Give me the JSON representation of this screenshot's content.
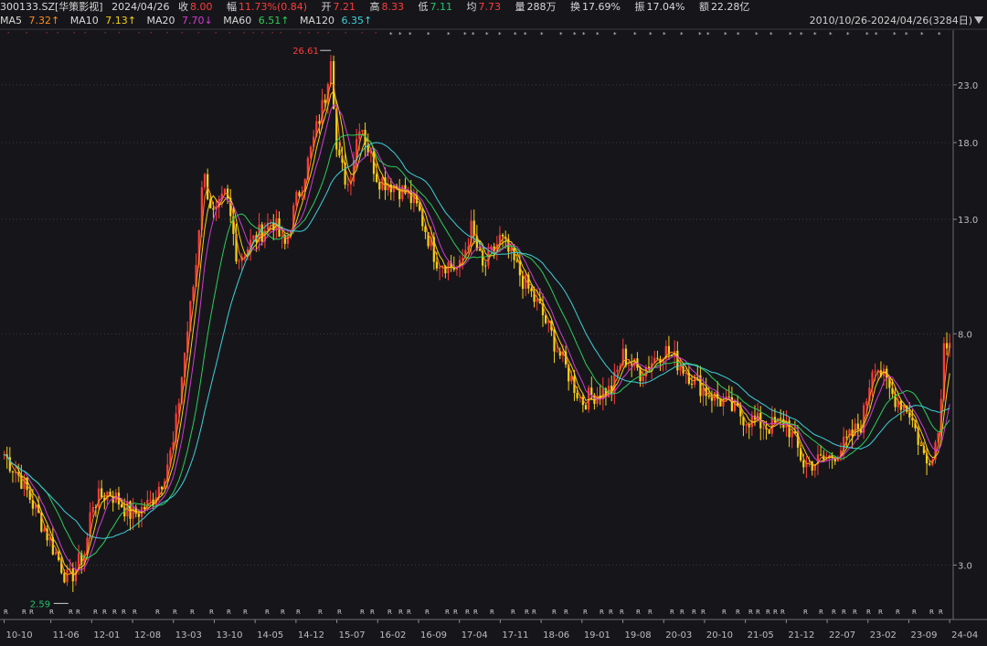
{
  "quote": {
    "symbol": "300133.SZ[华策影视]",
    "date": "2024/04/26",
    "close_label": "收",
    "close": "8.00",
    "change_label": "幅",
    "change": "11.73%(0.84)",
    "open_label": "开",
    "open": "7.21",
    "high_label": "高",
    "high": "8.33",
    "low_label": "低",
    "low": "7.11",
    "avg_label": "均",
    "avg": "7.73",
    "vol_label": "量",
    "vol": "288万",
    "turnover_label": "换",
    "turnover": "17.69%",
    "amplitude_label": "振",
    "amplitude": "17.04%",
    "amount_label": "额",
    "amount": "22.28亿"
  },
  "ma_legend": [
    {
      "label": "MA5",
      "value": "7.32↑",
      "color": "#ff8c1a"
    },
    {
      "label": "MA10",
      "value": "7.13↑",
      "color": "#f3d21a"
    },
    {
      "label": "MA20",
      "value": "7.70↓",
      "color": "#d23bd2"
    },
    {
      "label": "MA60",
      "value": "6.51↑",
      "color": "#2ecc5a"
    },
    {
      "label": "MA120",
      "value": "6.35↑",
      "color": "#3fd0d8"
    }
  ],
  "range_text": "2010/10/26-2024/04/26(3284日)",
  "colors": {
    "up": "#ff3b3b",
    "down": "#f3d21a",
    "bg": "#16161a",
    "grid": "#3a3a40"
  },
  "chart_data": {
    "type": "candlestick",
    "y_axis": {
      "scale": "log",
      "ticks": [
        "3.0",
        "8.0",
        "13.0",
        "18.0",
        "23.0"
      ],
      "ylim": [
        2.4,
        29
      ]
    },
    "x_ticks": [
      "10-10",
      "11-06",
      "12-01",
      "12-08",
      "13-03",
      "13-10",
      "14-05",
      "14-12",
      "15-07",
      "16-02",
      "16-09",
      "17-04",
      "17-11",
      "18-06",
      "19-01",
      "19-08",
      "20-03",
      "20-10",
      "21-05",
      "21-12",
      "22-07",
      "23-02",
      "23-09",
      "24-04"
    ],
    "annotations": {
      "max": "26.61",
      "min": "2.59"
    },
    "price_path": [
      [
        "10-10",
        4.8
      ],
      [
        "11-01",
        4.3
      ],
      [
        "11-06",
        3.3
      ],
      [
        "11-09",
        2.8
      ],
      [
        "11-12",
        3.2
      ],
      [
        "12-01",
        3.9
      ],
      [
        "12-04",
        4.1
      ],
      [
        "12-08",
        3.7
      ],
      [
        "12-11",
        3.9
      ],
      [
        "13-01",
        4.3
      ],
      [
        "13-03",
        5.0
      ],
      [
        "13-05",
        7.5
      ],
      [
        "13-07",
        11.0
      ],
      [
        "13-08",
        16.0
      ],
      [
        "13-10",
        13.0
      ],
      [
        "13-12",
        14.5
      ],
      [
        "14-02",
        11.0
      ],
      [
        "14-05",
        12.0
      ],
      [
        "14-08",
        13.0
      ],
      [
        "14-10",
        11.5
      ],
      [
        "14-12",
        14.0
      ],
      [
        "15-02",
        16.5
      ],
      [
        "15-05",
        22.0
      ],
      [
        "15-06",
        26.6
      ],
      [
        "15-07",
        17.0
      ],
      [
        "15-09",
        15.0
      ],
      [
        "15-11",
        20.0
      ],
      [
        "15-12",
        18.0
      ],
      [
        "16-02",
        15.5
      ],
      [
        "16-05",
        15.0
      ],
      [
        "16-07",
        14.5
      ],
      [
        "16-09",
        13.5
      ],
      [
        "16-12",
        11.0
      ],
      [
        "17-04",
        10.5
      ],
      [
        "17-06",
        12.5
      ],
      [
        "17-08",
        10.5
      ],
      [
        "17-11",
        12.0
      ],
      [
        "18-01",
        11.0
      ],
      [
        "18-03",
        10.0
      ],
      [
        "18-06",
        8.8
      ],
      [
        "18-10",
        7.0
      ],
      [
        "19-01",
        6.0
      ],
      [
        "19-03",
        6.2
      ],
      [
        "19-06",
        6.3
      ],
      [
        "19-08",
        7.3
      ],
      [
        "19-11",
        6.8
      ],
      [
        "20-03",
        7.5
      ],
      [
        "20-06",
        7.0
      ],
      [
        "20-10",
        6.3
      ],
      [
        "21-01",
        6.0
      ],
      [
        "21-05",
        5.6
      ],
      [
        "21-09",
        5.4
      ],
      [
        "21-12",
        5.5
      ],
      [
        "22-03",
        4.6
      ],
      [
        "22-07",
        4.7
      ],
      [
        "22-10",
        5.0
      ],
      [
        "23-01",
        5.5
      ],
      [
        "23-03",
        7.2
      ],
      [
        "23-06",
        6.2
      ],
      [
        "23-09",
        5.8
      ],
      [
        "23-12",
        4.6
      ],
      [
        "24-02",
        5.2
      ],
      [
        "24-03",
        7.6
      ],
      [
        "24-04",
        8.0
      ]
    ]
  }
}
